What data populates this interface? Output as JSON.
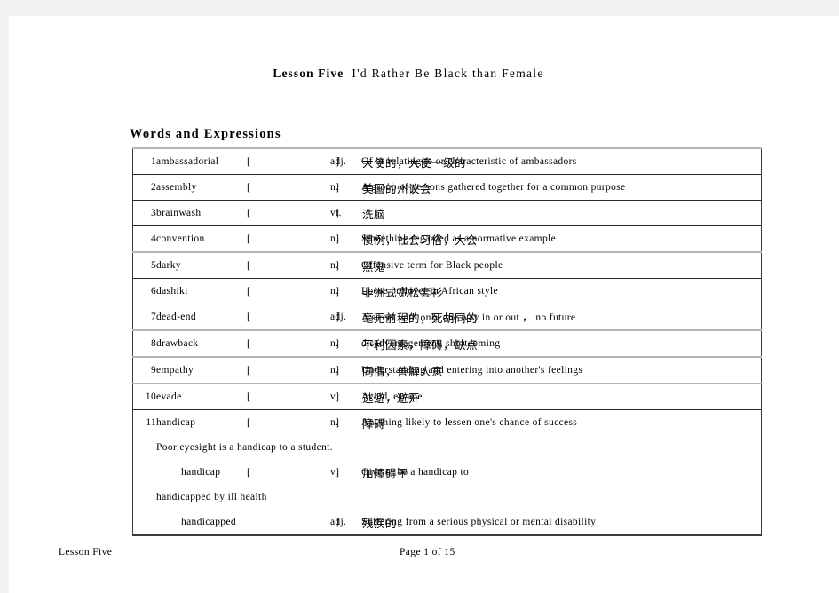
{
  "title": {
    "lesson": "Lesson Five",
    "subject": "I'd Rather Be Black than Female"
  },
  "section": {
    "heading": "Words and Expressions"
  },
  "table": {
    "bracket_open": "[",
    "bracket_close": "]",
    "rows": [
      {
        "num": "1",
        "word": "ambassadorial",
        "pos": "adj.",
        "chinese": "大使的，大使一级的",
        "definition": "Of or relating to or characteristic of ambassadors"
      },
      {
        "num": "2",
        "word": "assembly",
        "pos": "n.",
        "chinese": "美国的州议会",
        "definition": "A group of persons gathered together for a common purpose"
      },
      {
        "num": "3",
        "word": "brainwash",
        "pos": "vt.",
        "chinese": "洗脑",
        "definition": ""
      },
      {
        "num": "4",
        "word": "convention",
        "pos": "n.",
        "chinese": "惯例，社会习俗，大会",
        "definition": "Something regarded as a normative example"
      },
      {
        "num": "5",
        "word": "darky",
        "pos": "n.",
        "chinese": "黑鬼",
        "definition": "Offensive term for Black people"
      },
      {
        "num": "6",
        "word": "dashiki",
        "pos": "n.",
        "chinese": "非洲式宽松套衫",
        "definition": "Loose pullover in African style"
      },
      {
        "num": "7",
        "word": "dead-end",
        "pos": "adj.",
        "chinese": "毫无前程的，死胡同的",
        "definition": "A street with only one way in or out ，  no future"
      },
      {
        "num": "8",
        "word": "drawback",
        "pos": "n.",
        "chinese": "不利因素，障碍，缺点",
        "definition": "disadvantagement, shortcoming"
      },
      {
        "num": "9",
        "word": "empathy",
        "pos": "n.",
        "chinese": "同情，善解人意",
        "definition": "Understanding and entering into another's feelings"
      },
      {
        "num": "10",
        "word": "evade",
        "pos": "v.",
        "chinese": "逃避，避开",
        "definition": "Avoid, escape"
      },
      {
        "num": "11",
        "word": "handicap",
        "pos": "n.",
        "chinese": "障碍",
        "definition": "Anything likely to lessen one's chance of success"
      }
    ],
    "sub_entries": [
      {
        "type": "example",
        "text": "Poor eyesight is a handicap to a student."
      },
      {
        "type": "entry",
        "word": "handicap",
        "pos": "v.",
        "chinese": "加障碍于",
        "definition": "Give or be a handicap to"
      },
      {
        "type": "example",
        "text": "handicapped by ill health"
      },
      {
        "type": "entry",
        "word": "handicapped",
        "pos": "adj.",
        "chinese": "残疾的",
        "definition": "Suffering from a serious physical or mental disability"
      }
    ]
  },
  "footer": {
    "left": "Lesson Five",
    "page": "Page 1 of 15"
  }
}
